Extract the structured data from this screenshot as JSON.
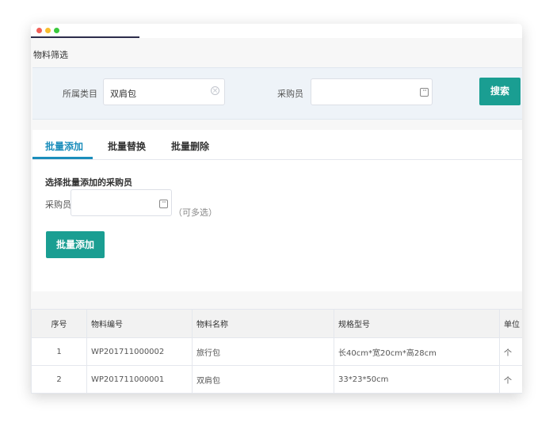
{
  "filter": {
    "title": "物料筛选",
    "category_label": "所属类目",
    "category_value": "双肩包",
    "buyer_label": "采购员",
    "buyer_value": "",
    "search_label": "搜索"
  },
  "tabs": [
    {
      "label": "批量添加",
      "active": true
    },
    {
      "label": "批量替换",
      "active": false
    },
    {
      "label": "批量删除",
      "active": false
    }
  ],
  "batch_add": {
    "section_title": "选择批量添加的采购员",
    "buyer_label": "采购员",
    "buyer_value": "",
    "hint": "（可多选）",
    "button_label": "批量添加"
  },
  "table": {
    "headers": [
      "序号",
      "物料编号",
      "物料名称",
      "规格型号",
      "单位"
    ],
    "rows": [
      [
        "1",
        "WP201711000002",
        "旅行包",
        "长40cm*宽20cm*高28cm",
        "个"
      ],
      [
        "2",
        "WP201711000001",
        "双肩包",
        "33*23*50cm",
        "个"
      ]
    ]
  },
  "colors": {
    "accent": "#1a9e92",
    "tab_active": "#1a8dbb",
    "filter_panel_bg": "#eef3f8"
  },
  "icons": [
    "window-close-dot",
    "window-minimize-dot",
    "window-maximize-dot",
    "clear-icon",
    "more-icon"
  ]
}
